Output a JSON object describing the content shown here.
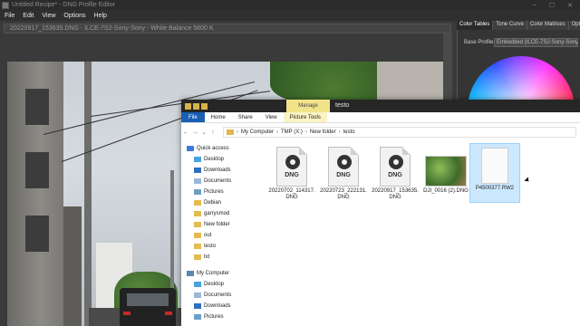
{
  "window": {
    "title": "Untitled Recipe* - DNG Profile Editor",
    "controls": [
      "–",
      "☐",
      "✕"
    ]
  },
  "menu": [
    "File",
    "Edit",
    "View",
    "Options",
    "Help"
  ],
  "document_tab": "20220917_153635.DNG - ILCE-7S2-Sony-Sony - White Balance 5600 K",
  "right_panel": {
    "tabs": [
      "Color Tables",
      "Tone Curve",
      "Color Matrices",
      "Optio"
    ],
    "active_tab": "Color Tables",
    "base_profile_label": "Base Profile:",
    "base_profile_value": "Embedded (ILCE-7S2-Sony-Sony"
  },
  "explorer": {
    "title": "testo",
    "context_tab": "Manage",
    "ribbon_tabs": [
      "File",
      "Home",
      "Share",
      "View",
      "Picture Tools"
    ],
    "address": [
      "My Computer",
      "TMP (X:)",
      "New folder",
      "testo"
    ],
    "quick_access_label": "Quick access",
    "nav_items": [
      {
        "label": "Desktop",
        "icon": "desktop-icon",
        "pinned": true
      },
      {
        "label": "Downloads",
        "icon": "downloads-icon",
        "pinned": true
      },
      {
        "label": "Documents",
        "icon": "documents-icon",
        "pinned": true
      },
      {
        "label": "Pictures",
        "icon": "pictures-icon",
        "pinned": true
      },
      {
        "label": "Debian",
        "icon": "folder-icon",
        "pinned": true
      },
      {
        "label": "garrysmod",
        "icon": "folder-icon",
        "pinned": true
      },
      {
        "label": "New folder",
        "icon": "folder-icon",
        "pinned": false
      },
      {
        "label": "out",
        "icon": "folder-icon",
        "pinned": false
      },
      {
        "label": "testo",
        "icon": "folder-icon",
        "pinned": false
      },
      {
        "label": "txt",
        "icon": "folder-icon",
        "pinned": false
      }
    ],
    "computer_label": "My Computer",
    "computer_items": [
      "Desktop",
      "Documents",
      "Downloads",
      "Pictures"
    ],
    "files": [
      {
        "name": "20220702_114317.\nDNG",
        "type": "dng",
        "selected": false
      },
      {
        "name": "20220723_222131.\nDNG",
        "type": "dng",
        "selected": false
      },
      {
        "name": "20220917_153635.\nDNG",
        "type": "dng",
        "selected": false
      },
      {
        "name": "DJI_0016 (2).DNG",
        "type": "thumb",
        "selected": false
      },
      {
        "name": "P4500377.RW2",
        "type": "blank",
        "selected": true
      }
    ],
    "dng_badge": "DNG"
  }
}
